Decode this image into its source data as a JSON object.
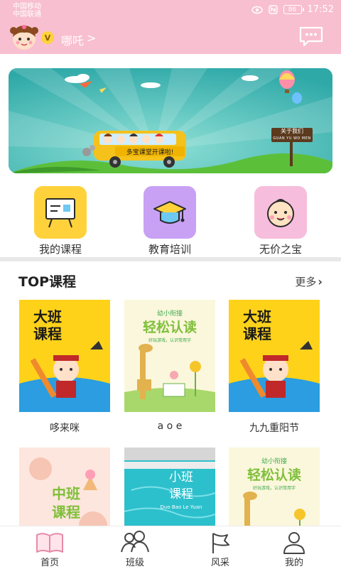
{
  "status_bar": {
    "carrier1": "中国移动",
    "carrier2": "中国联通",
    "battery": "86",
    "time": "17:52"
  },
  "header": {
    "vip_badge": "V",
    "username": "哪吒",
    "username_arrow": ">"
  },
  "banner": {
    "sign_text": "关于我们",
    "sign_subtext": "GUAN YU WO MEN",
    "bus_text": "多宝课堂开课啦!"
  },
  "categories": [
    {
      "label": "我的课程",
      "icon": "blackboard-icon"
    },
    {
      "label": "教育培训",
      "icon": "graduation-cap-icon"
    },
    {
      "label": "无价之宝",
      "icon": "baby-face-icon"
    }
  ],
  "section": {
    "title": "TOP课程",
    "more": "更多"
  },
  "courses": [
    {
      "title": "哆来咪",
      "badge1": "大班",
      "badge2": "课程"
    },
    {
      "title": "a o e",
      "top": "幼小衔接",
      "main": "轻松认读",
      "sub": "好玩游戏，认识常用字"
    },
    {
      "title": "九九重阳节",
      "badge1": "大班",
      "badge2": "课程"
    },
    {
      "title": "",
      "badge1": "中班",
      "badge2": "课程"
    },
    {
      "title": "",
      "main1": "小班",
      "main2": "课程",
      "sub": "Duo Bao Le Yuan"
    },
    {
      "title": "",
      "top": "幼小衔接",
      "main": "轻松认读",
      "sub": "好玩游戏，认识常用字"
    }
  ],
  "bottom_nav": [
    {
      "label": "首页"
    },
    {
      "label": "班级"
    },
    {
      "label": "风采"
    },
    {
      "label": "我的"
    }
  ],
  "colors": {
    "header_pink": "#f8bfd0",
    "banner_teal": "#3fb7b1",
    "tile_yellow": "#ffd23c",
    "tile_purple": "#c8a1f5",
    "tile_pink": "#f6bddc"
  }
}
